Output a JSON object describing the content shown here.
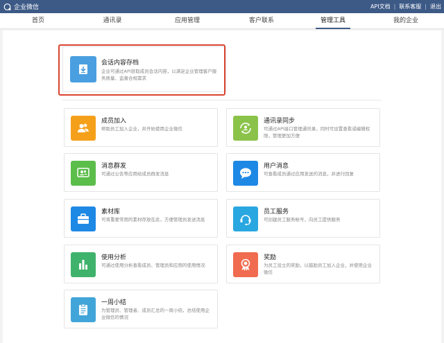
{
  "topbar": {
    "brand": "企业微信",
    "links": [
      "API文档",
      "联系客服",
      "退出"
    ]
  },
  "nav": {
    "items": [
      "首页",
      "通讯录",
      "应用管理",
      "客户联系",
      "管理工具",
      "我的企业"
    ],
    "active": "管理工具"
  },
  "featured": {
    "title": "会话内容存档",
    "desc": "企业可通过API获取成员会话内容，以满足企业管理客户服务质量、监督合规需求",
    "icon": "archive-download-icon",
    "color": "#4a9fe0"
  },
  "tools": [
    {
      "title": "成员加入",
      "desc": "帮助员工加入企业，并开始使用企业微信",
      "icon": "member-join-icon",
      "color": "#f5a01b"
    },
    {
      "title": "通讯录同步",
      "desc": "可通过API接口管理通讯录，同时可设置查看或编辑权限，管理更加方便",
      "icon": "contacts-sync-icon",
      "color": "#8bc34a"
    },
    {
      "title": "消息群发",
      "desc": "可通过公告等应用给成员群发消息",
      "icon": "broadcast-icon",
      "color": "#5bbd4a"
    },
    {
      "title": "用户消息",
      "desc": "可查看成员通过应用发送的消息，并进行回复",
      "icon": "chat-bubble-icon",
      "color": "#1e88e5"
    },
    {
      "title": "素材库",
      "desc": "可将重要常用的素材存放在此，方便管理员发送消息",
      "icon": "briefcase-icon",
      "color": "#1e88e5"
    },
    {
      "title": "员工服务",
      "desc": "可创建员工服务帐号，向员工提供服务",
      "icon": "headset-icon",
      "color": "#29a7e1"
    },
    {
      "title": "使用分析",
      "desc": "可通过使用分析查看成员、管理员和应用的使用情况",
      "icon": "bar-chart-icon",
      "color": "#3fb36b"
    },
    {
      "title": "奖励",
      "desc": "为员工设立的奖励，以鼓励员工加入企业，并使用企业微信",
      "icon": "medal-icon",
      "color": "#f06b4f"
    },
    {
      "title": "一周小结",
      "desc": "为管理员、管理者、成员汇总的一周小结，总结使用企业微信的情况",
      "icon": "clipboard-icon",
      "color": "#42a5d9"
    }
  ]
}
